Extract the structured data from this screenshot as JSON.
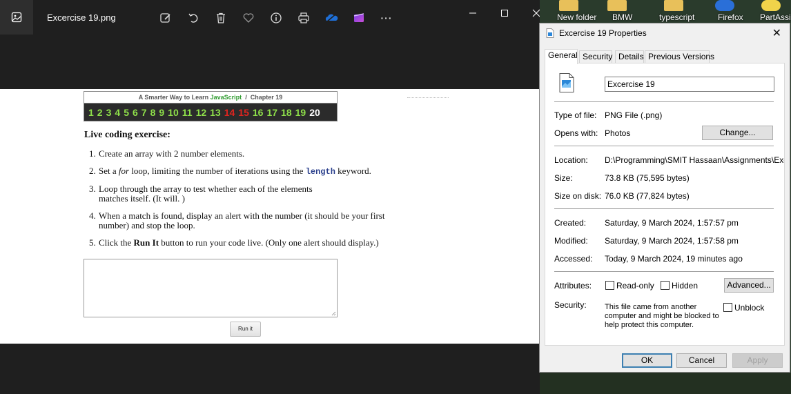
{
  "viewer": {
    "file_name": "Excercise 19.png",
    "toolbar_icons": [
      "edit-image-icon",
      "rotate-icon",
      "delete-icon",
      "favorite-icon",
      "info-icon",
      "print-icon",
      "onedrive-icon",
      "clipchamp-icon",
      "more-icon"
    ],
    "more_label": "···"
  },
  "page": {
    "banner_prefix": "A Smarter Way to Learn",
    "banner_brand": "JavaScript",
    "banner_sep": "/",
    "banner_chapter": "Chapter 19",
    "chapters": [
      {
        "n": "1",
        "c": "green"
      },
      {
        "n": "2",
        "c": "green"
      },
      {
        "n": "3",
        "c": "green"
      },
      {
        "n": "4",
        "c": "green"
      },
      {
        "n": "5",
        "c": "green"
      },
      {
        "n": "6",
        "c": "green"
      },
      {
        "n": "7",
        "c": "green"
      },
      {
        "n": "8",
        "c": "green"
      },
      {
        "n": "9",
        "c": "green"
      },
      {
        "n": "10",
        "c": "green"
      },
      {
        "n": "11",
        "c": "green"
      },
      {
        "n": "12",
        "c": "green"
      },
      {
        "n": "13",
        "c": "green"
      },
      {
        "n": "14",
        "c": "red"
      },
      {
        "n": "15",
        "c": "red"
      },
      {
        "n": "16",
        "c": "green"
      },
      {
        "n": "17",
        "c": "green"
      },
      {
        "n": "18",
        "c": "green"
      },
      {
        "n": "19",
        "c": "green"
      },
      {
        "n": "20",
        "c": "white"
      }
    ],
    "heading": "Live coding exercise:",
    "steps": {
      "s1_num": "1.",
      "s1": "Create an array with 2 number elements.",
      "s2_num": "2.",
      "s2_a": "Set a ",
      "s2_em": "for",
      "s2_b": " loop, limiting the number of iterations using the ",
      "s2_kw": "length",
      "s2_c": " keyword.",
      "s3_num": "3.",
      "s3_l1": "Loop through the array to test whether each of the elements",
      "s3_l2": "matches itself. (It will. )",
      "s4_num": "4.",
      "s4_l1": "When a match is found, display an alert with the number (it should be your first",
      "s4_l2": "number) and stop the loop.",
      "s5_num": "5.",
      "s5_a": "Click the ",
      "s5_b": "Run It",
      "s5_c": " button to run your code live. (Only one alert should display.)"
    },
    "run_button": "Run it"
  },
  "desktop": {
    "icons": [
      "New folder",
      "BMW",
      "typescript",
      "Firefox",
      "PartAssist"
    ]
  },
  "props": {
    "title": "Excercise 19 Properties",
    "close": "✕",
    "tabs": [
      "General",
      "Security",
      "Details",
      "Previous Versions"
    ],
    "file_name": "Excercise 19",
    "type_label": "Type of file:",
    "type_value": "PNG File (.png)",
    "opens_label": "Opens with:",
    "opens_value": "Photos",
    "change_button": "Change...",
    "location_label": "Location:",
    "location_value": "D:\\Programming\\SMIT Hassaan\\Assignments\\Exce",
    "size_label": "Size:",
    "size_value": "73.8 KB (75,595 bytes)",
    "disk_label": "Size on disk:",
    "disk_value": "76.0 KB (77,824 bytes)",
    "created_label": "Created:",
    "created_value": "Saturday, 9 March 2024, 1:57:57 pm",
    "modified_label": "Modified:",
    "modified_value": "Saturday, 9 March 2024, 1:57:58 pm",
    "accessed_label": "Accessed:",
    "accessed_value": "Today, 9 March 2024, 19 minutes ago",
    "attr_label": "Attributes:",
    "readonly": "Read-only",
    "hidden": "Hidden",
    "advanced_button": "Advanced...",
    "security_label": "Security:",
    "security_text": "This file came from another computer and might be blocked to help protect this computer.",
    "unblock": "Unblock",
    "ok": "OK",
    "cancel": "Cancel",
    "apply": "Apply"
  }
}
